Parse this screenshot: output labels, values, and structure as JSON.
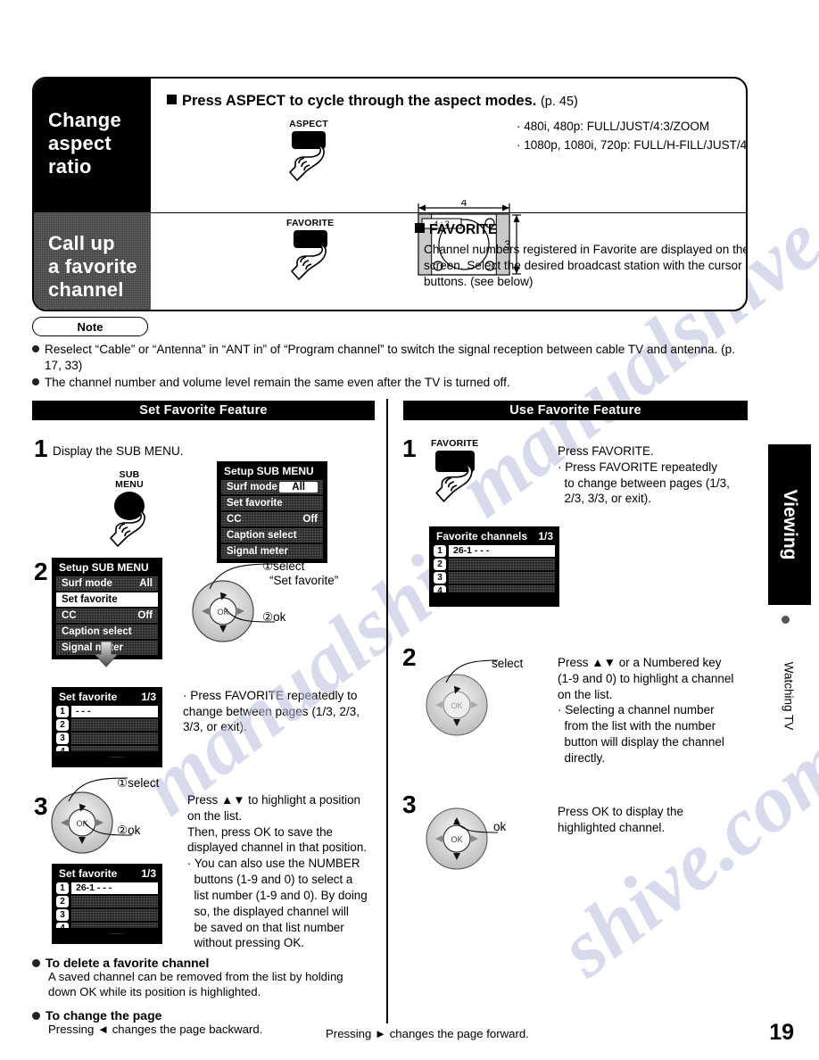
{
  "page_number": "19",
  "side_tab": {
    "label": "Viewing",
    "sub_label": "Watching TV"
  },
  "top_panel": {
    "aspect": {
      "title_label": "Change aspect ratio",
      "heading": "Press ASPECT to cycle through the aspect modes.",
      "heading_page_ref": "(p. 45)",
      "button_label": "ASPECT",
      "diagram": {
        "width_label": "4",
        "height_label": "3",
        "ratio_label": "4 : 3"
      },
      "modes": [
        "· 480i, 480p:  FULL/JUST/4:3/ZOOM",
        "· 1080p, 1080i, 720p:  FULL/H-FILL/JUST/4:3/ZOOM"
      ]
    },
    "favorite": {
      "title_label": "Call up a favorite channel",
      "button_label": "FAVORITE",
      "heading": "FAVORITE",
      "body": "Channel numbers registered in Favorite are displayed on the favorite tune screen. Select the desired broadcast station with the cursor or use number buttons. (see below)"
    }
  },
  "note": {
    "title": "Note",
    "items": [
      "Reselect “Cable” or “Antenna” in “ANT in” of “Program channel” to switch the signal reception between cable TV and antenna. (p. 17, 33)",
      "The channel number and volume level remain the same even after the TV is turned off."
    ]
  },
  "sections": {
    "set_favorite": {
      "bar_title": "Set Favorite Feature",
      "step1": {
        "number": "1",
        "text": "Display the SUB MENU.",
        "button_label_line1": "SUB",
        "button_label_line2": "MENU",
        "menu": {
          "title": "Setup SUB MENU",
          "rows": [
            {
              "label": "Surf mode",
              "value": "All",
              "highlight": false,
              "boxed_value": true
            },
            {
              "label": "Set favorite",
              "value": "",
              "highlight": false,
              "boxed_value": false
            },
            {
              "label": "CC",
              "value": "Off",
              "highlight": false,
              "boxed_value": false
            },
            {
              "label": "Caption select",
              "value": "",
              "highlight": false,
              "boxed_value": false
            },
            {
              "label": "Signal meter",
              "value": "",
              "highlight": false,
              "boxed_value": false
            }
          ]
        },
        "callouts": {
          "select_num": "①",
          "select": "select",
          "select_target": "“Set favorite”",
          "ok_num": "②",
          "ok": "ok"
        }
      },
      "step2": {
        "number": "2",
        "menu": {
          "title": "Setup SUB MENU",
          "rows": [
            {
              "label": "Surf mode",
              "value": "All",
              "highlight": false
            },
            {
              "label": "Set favorite",
              "value": "",
              "highlight": true
            },
            {
              "label": "CC",
              "value": "Off",
              "highlight": false
            },
            {
              "label": "Caption select",
              "value": "",
              "highlight": false
            },
            {
              "label": "Signal meter",
              "value": "",
              "highlight": false
            }
          ]
        },
        "list": {
          "title": "Set favorite",
          "page": "1/3",
          "rows": [
            {
              "num": "1",
              "value": "- - -",
              "selected": true
            },
            {
              "num": "2",
              "value": "",
              "selected": false
            },
            {
              "num": "3",
              "value": "",
              "selected": false
            },
            {
              "num": "4",
              "value": "",
              "selected": false
            }
          ]
        },
        "text": "· Press FAVORITE repeatedly to change between pages (1/3, 2/3, 3/3, or exit)."
      },
      "step3": {
        "number": "3",
        "callouts": {
          "select_num": "①",
          "select": "select",
          "ok_num": "②",
          "ok": "ok"
        },
        "list": {
          "title": "Set favorite",
          "page": "1/3",
          "rows": [
            {
              "num": "1",
              "value": "26-1      - - -",
              "selected": true
            },
            {
              "num": "2",
              "value": "",
              "selected": false
            },
            {
              "num": "3",
              "value": "",
              "selected": false
            },
            {
              "num": "4",
              "value": "",
              "selected": false
            }
          ]
        },
        "text_lines": [
          "Press ▲▼ to highlight a position",
          "on the list.",
          "Then, press OK to save the",
          "displayed channel in that position.",
          "· You can also use the NUMBER",
          "  buttons (1-9 and 0) to select a",
          "  list number (1-9 and 0). By doing",
          "  so, the displayed channel will",
          "  be saved on that list number",
          "  without pressing OK."
        ]
      }
    },
    "use_favorite": {
      "bar_title": "Use Favorite Feature",
      "step1": {
        "number": "1",
        "button_label": "FAVORITE",
        "list": {
          "title": "Favorite channels",
          "page": "1/3",
          "rows": [
            {
              "num": "1",
              "value": "26-1      - - -",
              "selected": true
            },
            {
              "num": "2",
              "value": "",
              "selected": false
            },
            {
              "num": "3",
              "value": "",
              "selected": false
            },
            {
              "num": "4",
              "value": "",
              "selected": false
            }
          ]
        },
        "text_lines": [
          "Press FAVORITE.",
          "· Press FAVORITE repeatedly",
          "  to change between pages (1/3,",
          "  2/3, 3/3, or exit)."
        ]
      },
      "step2": {
        "number": "2",
        "callout": "select",
        "text_lines": [
          "Press ▲▼ or a Numbered key",
          "(1-9 and 0) to highlight a channel",
          "on the list.",
          "· Selecting a channel number",
          "  from the list with the number",
          "  button will display the channel",
          "  directly."
        ]
      },
      "step3": {
        "number": "3",
        "callout": "ok",
        "text_lines": [
          "Press OK to display the",
          "highlighted channel."
        ]
      }
    }
  },
  "bottom_notes": {
    "delete": {
      "heading": "To delete a favorite channel",
      "body_lines": [
        "A saved channel can be removed from the list by holding",
        "down OK while its position is highlighted."
      ]
    },
    "change_page": {
      "heading": "To change the page",
      "left_text": "Pressing ◄ changes the page backward.",
      "right_text": "Pressing ► changes the page forward."
    }
  },
  "watermark": {
    "t1": "manualshive.com",
    "t2": "manualshive",
    "t3": "shive.com"
  }
}
